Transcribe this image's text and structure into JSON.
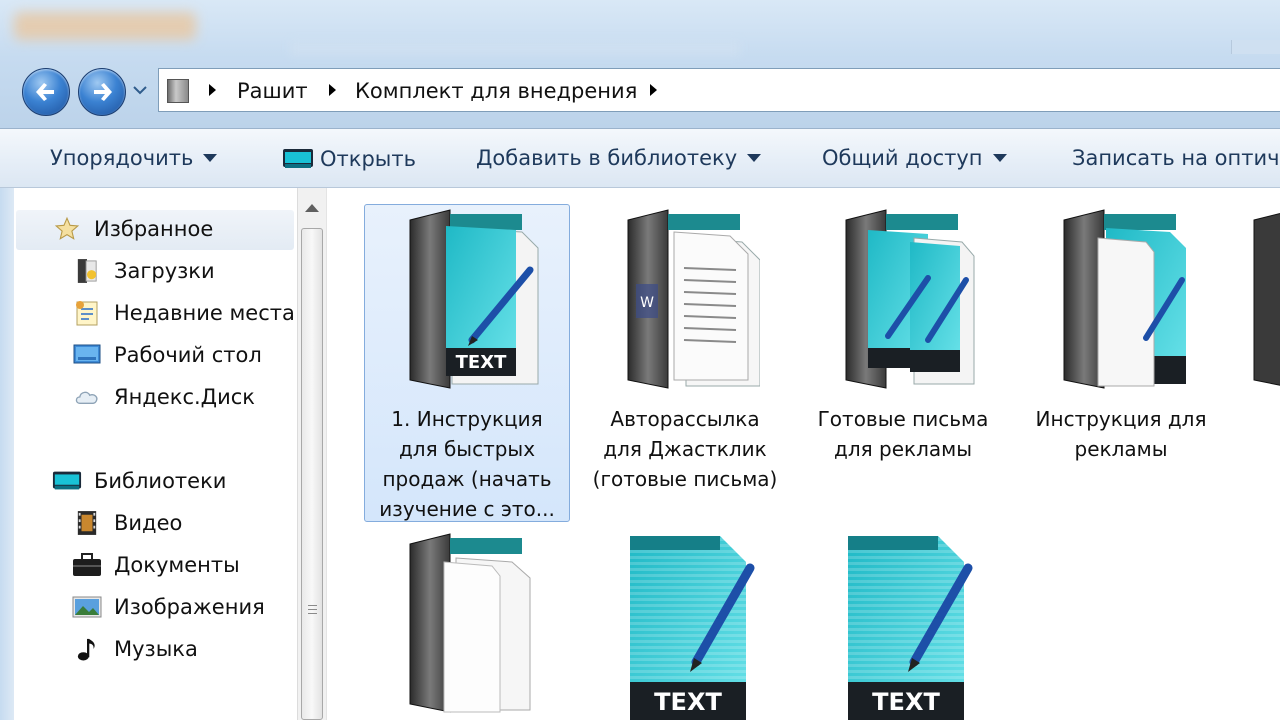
{
  "breadcrumb": [
    "Рашит",
    "Комплект для внедрения"
  ],
  "toolbar": {
    "organize": "Упорядочить",
    "open": "Открыть",
    "add_library": "Добавить в библиотеку",
    "share": "Общий доступ",
    "burn": "Записать на оптич"
  },
  "nav": {
    "favorites": "Избранное",
    "downloads": "Загрузки",
    "recent": "Недавние места",
    "desktop": "Рабочий стол",
    "yadisk": "Яндекс.Диск",
    "libraries": "Библиотеки",
    "video": "Видео",
    "documents": "Документы",
    "images": "Изображения",
    "music": "Музыка"
  },
  "files": [
    {
      "label": "1. Инструкция для быстрых продаж (начать изучение с это...",
      "type": "text-folder",
      "selected": true
    },
    {
      "label": "Авторассылка для Джастклик (готовые письма)",
      "type": "doc-folder"
    },
    {
      "label": "Готовые письма для рекламы",
      "type": "text-folder"
    },
    {
      "label": "Инструкция для рекламы",
      "type": "text-folder"
    },
    {
      "label": "",
      "type": "empty-folder"
    },
    {
      "label": "",
      "type": "text-file"
    },
    {
      "label": "",
      "type": "text-file"
    }
  ],
  "file_badge_text": "TEXT",
  "doc_badge_text": "W",
  "colors": {
    "selection": "#d4e6fb",
    "selection_border": "#84acdd",
    "toolbar_text": "#1e395b"
  }
}
